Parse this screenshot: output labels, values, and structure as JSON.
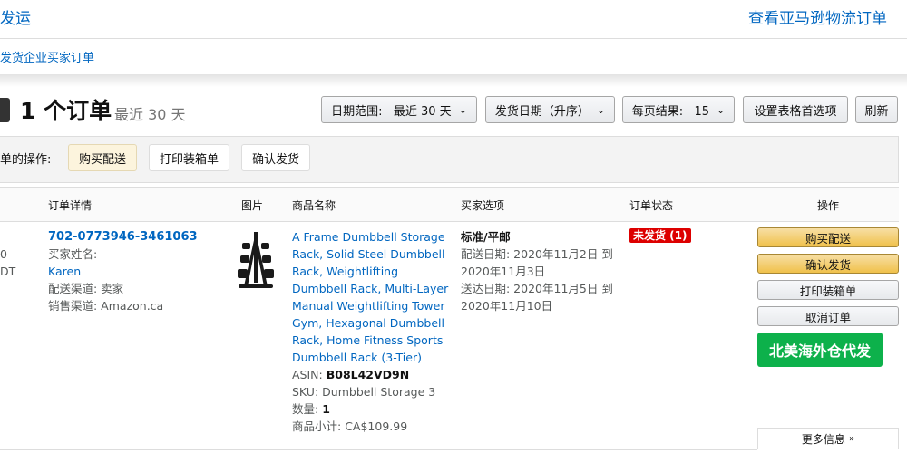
{
  "header": {
    "title": "发运",
    "right_link": "查看亚马逊物流订单",
    "filter_link": "发货企业买家订单"
  },
  "summary": {
    "count": "1 个订单",
    "range": "最近 30 天"
  },
  "controls": {
    "date_range": "日期范围:   最近 30 天",
    "sort": "发货日期（升序）",
    "per_page": "每页结果:   15",
    "settings": "设置表格首选项",
    "refresh": "刷新"
  },
  "bulk": {
    "label": "单的操作:",
    "buy_shipping": "购买配送",
    "print_slip": "打印装箱单",
    "confirm_ship": "确认发货"
  },
  "table": {
    "headers": [
      "订单详情",
      "图片",
      "商品名称",
      "买家选项",
      "订单状态",
      "操作"
    ]
  },
  "order": {
    "cut_left_1": "0",
    "cut_left_2": "DT",
    "id": "702-0773946-3461063",
    "buyer_label": "买家姓名:",
    "buyer_name": "Karen",
    "channel": "配送渠道: 卖家",
    "sales_channel": "销售渠道: Amazon.ca",
    "product_name": "A Frame Dumbbell Storage Rack, Solid Steel Dumbbell Rack, Weightlifting Dumbbell Rack, Multi-Layer Manual Weightlifting Tower Gym, Hexagonal Dumbbell Rack, Home Fitness Sports Dumbbell Rack (3-Tier)",
    "asin_label": "ASIN:",
    "asin": "B08L42VD9N",
    "sku_label": "SKU:",
    "sku": "Dumbbell Storage 3",
    "qty_label": "数量:",
    "qty": "1",
    "subtotal_label": "商品小计:",
    "subtotal": "CA$109.99",
    "ship_type": "标准/平邮",
    "ship_date": "配送日期: 2020年11月2日 到 2020年11月3日",
    "deliv_date": "送达日期: 2020年11月5日 到 2020年11月10日",
    "status": "未发货 (1)"
  },
  "actions": {
    "buy_shipping": "购买配送",
    "confirm_ship": "确认发货",
    "print_slip": "打印装箱单",
    "cancel": "取消订单",
    "warehouse": "北美海外仓代发",
    "more_info": "更多信息"
  },
  "colors": {
    "link": "#0066c0",
    "status_red": "#dd0000",
    "primary_yellow": "#f0c14b",
    "green": "#0db14b"
  }
}
